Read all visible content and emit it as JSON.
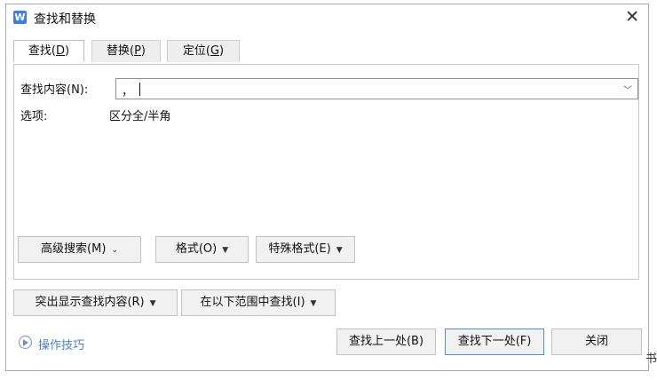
{
  "window": {
    "title": "查找和替换",
    "app_icon_letter": "W"
  },
  "tabs": [
    {
      "label": "查找",
      "key": "D",
      "active": true
    },
    {
      "label": "替换",
      "key": "P",
      "active": false
    },
    {
      "label": "定位",
      "key": "G",
      "active": false
    }
  ],
  "find": {
    "label": "查找内容(N):",
    "value": "，"
  },
  "options": {
    "label": "选项:",
    "value": "区分全/半角"
  },
  "panel_buttons": {
    "advanced": "高级搜索(M)",
    "format": "格式(O)",
    "special": "特殊格式(E)"
  },
  "lower_buttons": {
    "highlight": "突出显示查找内容(R)",
    "search_in": "在以下范围中查找(I)"
  },
  "footer": {
    "tips": "操作技巧",
    "find_prev": "查找上一处(B)",
    "find_next": "查找下一处(F)",
    "close": "关闭"
  },
  "edge_char": "书"
}
